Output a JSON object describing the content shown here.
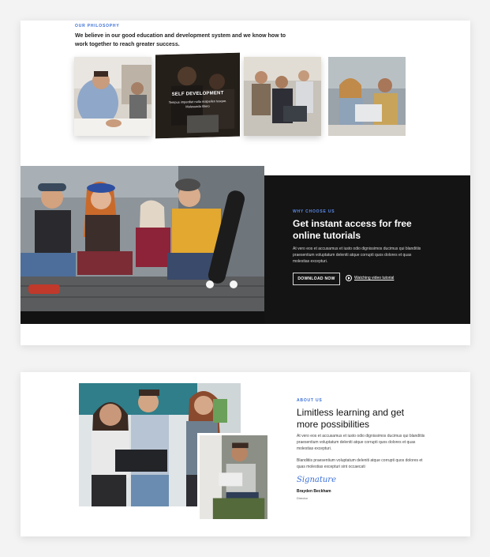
{
  "philosophy": {
    "eyebrow": "OUR PHILOSOPHY",
    "text": "We believe in our good education and development system and we know how to work together to reach greater success.",
    "cards": [
      {
        "title": "SELF DEVELOPMENT",
        "subtitle": "Tempus imperdiet nulla malpellen tesque. Malesuada libero"
      }
    ]
  },
  "why": {
    "eyebrow": "WHY CHOOSE US",
    "title": "Get instant access for free online tutorials",
    "text": "At vero eos et accusamus et iusto odio dignissimos ducimus qui blanditiis praesentium voluptatum deleniti atque corrupti quos dolores et quas molestias excepturi.",
    "button": "DOWNLOAD NOW",
    "link": "Watching video tutorial"
  },
  "about": {
    "eyebrow": "ABOUT US",
    "title": "Limitless learning and get more possibilities",
    "text1": "At vero eos et accusamus et iusto odio dignissimos ducimus qui blanditiis praesentium voluptatum deleniti atque corrupti quos dolores et quas molestias excepturi.",
    "text2": "Blanditiis praesentium voluptatum deleniti atque corrupti quos dolores et quas molestias excepturi sint occaecati",
    "signature": "Signature",
    "author": "Brayden Beckham",
    "role": "Director"
  },
  "colors": {
    "accent": "#3a6fd8",
    "dark_panel": "#141414"
  }
}
